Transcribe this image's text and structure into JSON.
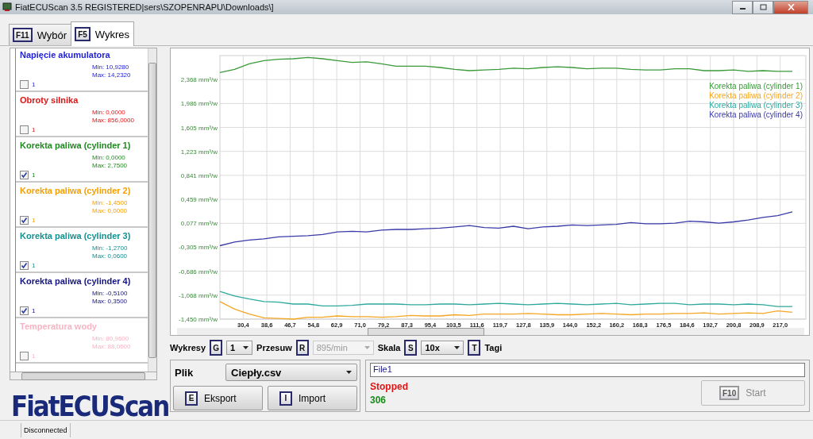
{
  "window": {
    "title": "FiatECUScan 3.5 REGISTERED|sers\\SZOPENRAPU\\Downloads\\]"
  },
  "tabs": [
    {
      "key": "F11",
      "label": "Wybór",
      "selected": false
    },
    {
      "key": "F5",
      "label": "Wykres",
      "selected": true
    }
  ],
  "channels": [
    {
      "name": "Napięcie akumulatora",
      "min": "Min: 10,9280",
      "max": "Max: 14,2320",
      "checked": false,
      "count": "1",
      "color": "#2222dd"
    },
    {
      "name": "Obroty silnika",
      "min": "Min: 0,0000",
      "max": "Max: 856,0000",
      "checked": false,
      "count": "1",
      "color": "#e01515"
    },
    {
      "name": "Korekta paliwa (cylinder 1)",
      "min": "Min: 0,0000",
      "max": "Max: 2,7500",
      "checked": true,
      "count": "1",
      "color": "#1f8a1f"
    },
    {
      "name": "Korekta paliwa (cylinder 2)",
      "min": "Min: -1,4500",
      "max": "Max: 0,0000",
      "checked": true,
      "count": "1",
      "color": "#f5a000"
    },
    {
      "name": "Korekta paliwa (cylinder 3)",
      "min": "Min: -1,2700",
      "max": "Max: 0,0600",
      "checked": true,
      "count": "1",
      "color": "#139191"
    },
    {
      "name": "Korekta paliwa (cylinder 4)",
      "min": "Min: -0,5100",
      "max": "Max: 0,3500",
      "checked": true,
      "count": "1",
      "color": "#141480"
    },
    {
      "name": "Temperatura wody",
      "min": "Min: 80,9600",
      "max": "Max: 88,0600",
      "checked": false,
      "count": "1",
      "color": "#f8b4c4"
    }
  ],
  "logo": "FiatECUScan",
  "chart": {
    "chart_data": {
      "type": "line",
      "grid": true,
      "ylim": [
        -1.45,
        2.75
      ],
      "xlim": [
        22.3,
        225.9
      ],
      "x": [
        22.3,
        27.4,
        32.5,
        37.6,
        42.7,
        47.8,
        52.9,
        58.0,
        63.1,
        68.2,
        73.3,
        78.4,
        83.5,
        88.6,
        93.7,
        98.8,
        103.9,
        109.0,
        114.1,
        119.2,
        124.3,
        129.4,
        134.5,
        139.6,
        144.7,
        149.8,
        154.9,
        160.0,
        165.1,
        170.2,
        175.3,
        180.4,
        185.5,
        190.6,
        195.7,
        200.8,
        205.9,
        211.0,
        216.1,
        221.2
      ],
      "yticks": [
        {
          "value": 2.368,
          "label": "2,368 mm³/w"
        },
        {
          "value": 1.986,
          "label": "1,986 mm³/w"
        },
        {
          "value": 1.605,
          "label": "1,605 mm³/w"
        },
        {
          "value": 1.223,
          "label": "1,223 mm³/w"
        },
        {
          "value": 0.841,
          "label": "0,841 mm³/w"
        },
        {
          "value": 0.459,
          "label": "0,459 mm³/w"
        },
        {
          "value": 0.077,
          "label": "0,077 mm³/w"
        },
        {
          "value": -0.305,
          "label": "-0,305 mm³/w"
        },
        {
          "value": -0.686,
          "label": "-0,686 mm³/w"
        },
        {
          "value": -1.068,
          "label": "-1,068 mm³/w"
        },
        {
          "value": -1.45,
          "label": "-1,450 mm³/w"
        }
      ],
      "xticks": [
        {
          "value": 30.4,
          "label": "30,4"
        },
        {
          "value": 38.6,
          "label": "38,6"
        },
        {
          "value": 46.7,
          "label": "46,7"
        },
        {
          "value": 54.8,
          "label": "54,8"
        },
        {
          "value": 62.9,
          "label": "62,9"
        },
        {
          "value": 71.0,
          "label": "71,0"
        },
        {
          "value": 79.2,
          "label": "79,2"
        },
        {
          "value": 87.3,
          "label": "87,3"
        },
        {
          "value": 95.4,
          "label": "95,4"
        },
        {
          "value": 103.5,
          "label": "103,5"
        },
        {
          "value": 111.6,
          "label": "111,6"
        },
        {
          "value": 119.7,
          "label": "119,7"
        },
        {
          "value": 127.8,
          "label": "127,8"
        },
        {
          "value": 135.9,
          "label": "135,9"
        },
        {
          "value": 144.0,
          "label": "144,0"
        },
        {
          "value": 152.2,
          "label": "152,2"
        },
        {
          "value": 160.2,
          "label": "160,2"
        },
        {
          "value": 168.3,
          "label": "168,3"
        },
        {
          "value": 176.5,
          "label": "176,5"
        },
        {
          "value": 184.6,
          "label": "184,6"
        },
        {
          "value": 192.7,
          "label": "192,7"
        },
        {
          "value": 200.8,
          "label": "200,8"
        },
        {
          "value": 208.9,
          "label": "208,9"
        },
        {
          "value": 217.0,
          "label": "217,0"
        }
      ],
      "series": [
        {
          "name": "Korekta paliwa (cylinder 1)",
          "color": "#3a9a3a",
          "values": [
            2.48,
            2.53,
            2.62,
            2.67,
            2.69,
            2.7,
            2.72,
            2.7,
            2.67,
            2.64,
            2.65,
            2.62,
            2.58,
            2.58,
            2.58,
            2.56,
            2.53,
            2.51,
            2.52,
            2.53,
            2.55,
            2.54,
            2.56,
            2.57,
            2.56,
            2.54,
            2.55,
            2.55,
            2.53,
            2.52,
            2.52,
            2.54,
            2.54,
            2.51,
            2.51,
            2.52,
            2.5,
            2.51,
            2.5,
            2.5
          ]
        },
        {
          "name": "Korekta paliwa (cylinder 2)",
          "color": "#f5a623",
          "values": [
            -1.17,
            -1.29,
            -1.37,
            -1.43,
            -1.44,
            -1.45,
            -1.42,
            -1.42,
            -1.4,
            -1.41,
            -1.41,
            -1.42,
            -1.41,
            -1.39,
            -1.4,
            -1.4,
            -1.38,
            -1.39,
            -1.37,
            -1.37,
            -1.37,
            -1.36,
            -1.37,
            -1.38,
            -1.38,
            -1.37,
            -1.36,
            -1.37,
            -1.38,
            -1.37,
            -1.37,
            -1.36,
            -1.36,
            -1.35,
            -1.37,
            -1.36,
            -1.35,
            -1.36,
            -1.32,
            -1.34
          ]
        },
        {
          "name": "Korekta paliwa (cylinder 3)",
          "color": "#2fa89e",
          "values": [
            -1.01,
            -1.08,
            -1.13,
            -1.17,
            -1.18,
            -1.21,
            -1.21,
            -1.24,
            -1.24,
            -1.23,
            -1.21,
            -1.21,
            -1.21,
            -1.22,
            -1.22,
            -1.21,
            -1.21,
            -1.22,
            -1.21,
            -1.2,
            -1.21,
            -1.22,
            -1.21,
            -1.2,
            -1.21,
            -1.22,
            -1.21,
            -1.2,
            -1.22,
            -1.21,
            -1.2,
            -1.2,
            -1.22,
            -1.21,
            -1.21,
            -1.22,
            -1.21,
            -1.22,
            -1.25,
            -1.25
          ]
        },
        {
          "name": "Korekta paliwa (cylinder 4)",
          "color": "#3a3aa8",
          "values": [
            -0.28,
            -0.22,
            -0.19,
            -0.17,
            -0.14,
            -0.13,
            -0.12,
            -0.1,
            -0.06,
            -0.05,
            -0.06,
            -0.03,
            -0.02,
            -0.02,
            -0.01,
            0.0,
            0.02,
            0.04,
            0.01,
            0.0,
            0.03,
            -0.01,
            0.02,
            0.03,
            0.05,
            0.04,
            0.05,
            0.06,
            0.09,
            0.07,
            0.07,
            0.08,
            0.11,
            0.1,
            0.08,
            0.1,
            0.13,
            0.17,
            0.2,
            0.26
          ]
        }
      ]
    }
  },
  "controls": [
    {
      "label": "Wykresy",
      "key": "G",
      "value": "1",
      "disabled": false
    },
    {
      "label": "Przesuw",
      "key": "R",
      "value": "895/min",
      "disabled": true
    },
    {
      "label": "Skala",
      "key": "S",
      "value": "10x",
      "disabled": false
    }
  ],
  "tags": {
    "key": "T",
    "label": "Tagi"
  },
  "file": {
    "label": "Plik",
    "value": "Ciepły.csv",
    "buttons": [
      {
        "key": "E",
        "label": "Eksport"
      },
      {
        "key": "I",
        "label": "Import"
      }
    ]
  },
  "run": {
    "field": "File1",
    "state": "Stopped",
    "count": "306",
    "start": {
      "key": "F10",
      "label": "Start",
      "disabled": true
    }
  },
  "status_bar": {
    "text": "Disconnected"
  }
}
